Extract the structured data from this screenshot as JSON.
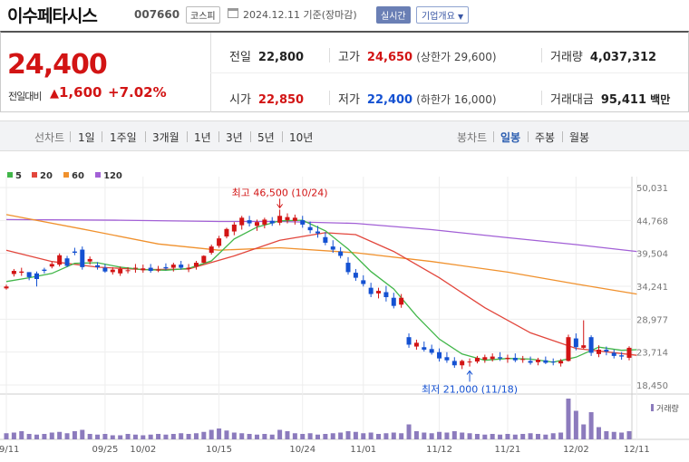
{
  "header": {
    "title": "이수페타시스",
    "code": "007660",
    "market": "코스피",
    "date": "2024.12.11 기준(장마감)",
    "realtime": "실시간",
    "overview": "기업개요"
  },
  "summary": {
    "price": "24,400",
    "prev_label": "전일대비",
    "change": "1,600",
    "change_pct": "+7.02%",
    "prev_close_label": "전일",
    "prev_close": "22,800",
    "open_label": "시가",
    "open": "22,850",
    "high_label": "고가",
    "high": "24,650",
    "upper_limit": "(상한가 29,600)",
    "low_label": "저가",
    "low": "22,400",
    "lower_limit": "(하한가 16,000)",
    "volume_label": "거래량",
    "volume": "4,037,312",
    "amount_label": "거래대금",
    "amount": "95,411",
    "amount_unit": "백만"
  },
  "period_tabs": {
    "line_label": "선차트",
    "items": [
      "1일",
      "1주일",
      "3개월",
      "1년",
      "3년",
      "5년",
      "10년"
    ],
    "candle_label": "봉차트",
    "candle_items": [
      "일봉",
      "주봉",
      "월봉"
    ],
    "selected_candle": "일봉"
  },
  "colors": {
    "up": "#d21414",
    "down": "#1451d2",
    "ma5": "#41b649",
    "ma20": "#e2463c",
    "ma60": "#f0912d",
    "ma120": "#a260d6"
  },
  "chart_data": {
    "type": "candlestick",
    "legend": [
      {
        "name": "5",
        "color": "#41b649"
      },
      {
        "name": "20",
        "color": "#e2463c"
      },
      {
        "name": "60",
        "color": "#f0912d"
      },
      {
        "name": "120",
        "color": "#a260d6"
      }
    ],
    "y_ticks": [
      "50,031",
      "44,768",
      "39,504",
      "34,241",
      "28,977",
      "23,714",
      "18,450"
    ],
    "ylim": [
      18450,
      50031
    ],
    "x_ticks": [
      "09/11",
      "09/25",
      "10/02",
      "10/15",
      "10/24",
      "11/01",
      "11/12",
      "11/21",
      "12/02",
      "12/11"
    ],
    "x_tick_index": [
      0,
      13,
      18,
      28,
      39,
      47,
      57,
      66,
      75,
      83
    ],
    "max_label": "최고 46,500 (10/24)",
    "max_index": 36,
    "max_value": 46500,
    "min_label": "최저 21,000 (11/18)",
    "min_index": 61,
    "min_value": 21000,
    "volume_label": "거래량",
    "candles": [
      [
        33900,
        34500,
        33700,
        34200
      ],
      [
        36200,
        37000,
        35800,
        36700
      ],
      [
        36400,
        37200,
        35900,
        36600
      ],
      [
        36500,
        36500,
        35200,
        35700
      ],
      [
        36300,
        36600,
        34200,
        35400
      ],
      [
        36900,
        37200,
        36300,
        36700
      ],
      [
        37400,
        38200,
        37100,
        37800
      ],
      [
        37700,
        39500,
        37400,
        39200
      ],
      [
        38700,
        39100,
        37300,
        37500
      ],
      [
        39800,
        40400,
        39200,
        39600
      ],
      [
        40100,
        40600,
        36900,
        37300
      ],
      [
        38200,
        39000,
        37700,
        38600
      ],
      [
        37600,
        38100,
        36900,
        37300
      ],
      [
        37200,
        37800,
        36400,
        36600
      ],
      [
        36500,
        37300,
        36100,
        36900
      ],
      [
        36300,
        37400,
        35900,
        37000
      ],
      [
        36700,
        37300,
        36300,
        36800
      ],
      [
        37100,
        37800,
        36400,
        37200
      ],
      [
        36800,
        37700,
        36400,
        37100
      ],
      [
        37200,
        37800,
        36400,
        36700
      ],
      [
        36900,
        37500,
        36500,
        36900
      ],
      [
        37300,
        37900,
        36800,
        37100
      ],
      [
        37200,
        38000,
        36600,
        37700
      ],
      [
        37700,
        38300,
        36900,
        37200
      ],
      [
        37000,
        37800,
        36500,
        37200
      ],
      [
        37400,
        38300,
        36900,
        38000
      ],
      [
        38000,
        39200,
        37900,
        39100
      ],
      [
        39600,
        40900,
        39300,
        40600
      ],
      [
        40700,
        42300,
        40400,
        41900
      ],
      [
        42200,
        43600,
        41900,
        43400
      ],
      [
        43000,
        44500,
        42400,
        44100
      ],
      [
        44000,
        45500,
        43300,
        45200
      ],
      [
        44800,
        45500,
        43800,
        44300
      ],
      [
        43900,
        44900,
        43100,
        44500
      ],
      [
        44100,
        45200,
        43500,
        44900
      ],
      [
        44700,
        45300,
        43900,
        44300
      ],
      [
        44400,
        46500,
        44000,
        45500
      ],
      [
        44800,
        45900,
        44300,
        45300
      ],
      [
        44700,
        45700,
        44100,
        45200
      ],
      [
        44800,
        45500,
        43600,
        44100
      ],
      [
        43700,
        44600,
        42700,
        43200
      ],
      [
        43000,
        43900,
        42000,
        42700
      ],
      [
        42100,
        42900,
        40800,
        41200
      ],
      [
        40600,
        41600,
        39600,
        40100
      ],
      [
        39800,
        40500,
        38700,
        39100
      ],
      [
        38000,
        38900,
        36100,
        36500
      ],
      [
        36400,
        37000,
        35100,
        35600
      ],
      [
        35200,
        36000,
        34200,
        34600
      ],
      [
        34000,
        34800,
        32500,
        33000
      ],
      [
        33100,
        34000,
        32300,
        33500
      ],
      [
        33300,
        34300,
        31800,
        32500
      ],
      [
        32400,
        33200,
        30700,
        31100
      ],
      [
        31300,
        33000,
        30800,
        32400
      ],
      [
        26100,
        26700,
        24400,
        24900
      ],
      [
        24600,
        25700,
        24100,
        25200
      ],
      [
        24500,
        25400,
        23800,
        24100
      ],
      [
        24200,
        24900,
        23300,
        23600
      ],
      [
        23700,
        24300,
        22200,
        22700
      ],
      [
        22900,
        23700,
        22000,
        22400
      ],
      [
        22300,
        22900,
        21200,
        21600
      ],
      [
        21600,
        22500,
        21000,
        22300
      ],
      [
        22100,
        22700,
        21400,
        22200
      ],
      [
        22200,
        23100,
        21900,
        22800
      ],
      [
        22500,
        23300,
        22000,
        22900
      ],
      [
        22600,
        23500,
        22200,
        23000
      ],
      [
        22900,
        23700,
        22300,
        22700
      ],
      [
        22600,
        23300,
        22000,
        22800
      ],
      [
        22800,
        23500,
        22100,
        22400
      ],
      [
        22500,
        23100,
        22000,
        22600
      ],
      [
        22300,
        23000,
        21700,
        22000
      ],
      [
        22100,
        22800,
        21600,
        22500
      ],
      [
        22400,
        23000,
        21800,
        22000
      ],
      [
        22200,
        22700,
        21600,
        22100
      ],
      [
        21900,
        22600,
        21400,
        22300
      ],
      [
        22300,
        26500,
        22200,
        26100
      ],
      [
        25900,
        26700,
        24000,
        24500
      ],
      [
        24400,
        28800,
        24200,
        24800
      ],
      [
        26100,
        26400,
        23100,
        23600
      ],
      [
        23400,
        24800,
        22900,
        24100
      ],
      [
        24100,
        24600,
        23200,
        23800
      ],
      [
        23600,
        24100,
        22700,
        23100
      ],
      [
        23200,
        23700,
        22500,
        23000
      ],
      [
        22800,
        24650,
        22400,
        24400
      ]
    ],
    "volumes": [
      45,
      50,
      60,
      40,
      35,
      40,
      50,
      55,
      45,
      60,
      70,
      40,
      35,
      40,
      30,
      30,
      40,
      35,
      30,
      35,
      40,
      35,
      40,
      45,
      40,
      45,
      55,
      70,
      80,
      65,
      50,
      45,
      40,
      35,
      40,
      35,
      70,
      60,
      45,
      40,
      45,
      35,
      40,
      45,
      50,
      60,
      55,
      45,
      50,
      40,
      45,
      50,
      45,
      110,
      60,
      50,
      45,
      55,
      50,
      60,
      50,
      45,
      40,
      35,
      40,
      35,
      40,
      35,
      40,
      45,
      40,
      35,
      45,
      50,
      300,
      210,
      110,
      200,
      90,
      60,
      55,
      50,
      60
    ],
    "ma5": [
      [
        0,
        35000
      ],
      [
        3,
        35600
      ],
      [
        6,
        36300
      ],
      [
        9,
        37900
      ],
      [
        12,
        38000
      ],
      [
        15,
        37300
      ],
      [
        18,
        36900
      ],
      [
        21,
        36800
      ],
      [
        24,
        37100
      ],
      [
        27,
        38300
      ],
      [
        30,
        41800
      ],
      [
        33,
        43700
      ],
      [
        36,
        44700
      ],
      [
        39,
        44800
      ],
      [
        42,
        43100
      ],
      [
        45,
        40200
      ],
      [
        48,
        36600
      ],
      [
        51,
        33800
      ],
      [
        54,
        29500
      ],
      [
        57,
        25800
      ],
      [
        60,
        23400
      ],
      [
        63,
        22400
      ],
      [
        66,
        22700
      ],
      [
        69,
        22600
      ],
      [
        72,
        22100
      ],
      [
        75,
        22900
      ],
      [
        78,
        24500
      ],
      [
        81,
        24000
      ],
      [
        83,
        24100
      ]
    ],
    "ma20": [
      [
        0,
        40000
      ],
      [
        6,
        38200
      ],
      [
        12,
        37300
      ],
      [
        18,
        36900
      ],
      [
        24,
        37000
      ],
      [
        30,
        39100
      ],
      [
        36,
        41600
      ],
      [
        42,
        42800
      ],
      [
        46,
        42500
      ],
      [
        51,
        39800
      ],
      [
        57,
        35600
      ],
      [
        63,
        30800
      ],
      [
        69,
        26800
      ],
      [
        75,
        24300
      ],
      [
        83,
        23200
      ]
    ],
    "ma60": [
      [
        0,
        45700
      ],
      [
        10,
        43400
      ],
      [
        20,
        41000
      ],
      [
        28,
        40000
      ],
      [
        36,
        40400
      ],
      [
        46,
        39600
      ],
      [
        56,
        38200
      ],
      [
        66,
        36500
      ],
      [
        75,
        34600
      ],
      [
        83,
        33000
      ]
    ],
    "ma120": [
      [
        0,
        44900
      ],
      [
        15,
        44800
      ],
      [
        28,
        44600
      ],
      [
        36,
        44600
      ],
      [
        46,
        44300
      ],
      [
        56,
        43300
      ],
      [
        66,
        42000
      ],
      [
        75,
        40900
      ],
      [
        83,
        39800
      ]
    ]
  }
}
